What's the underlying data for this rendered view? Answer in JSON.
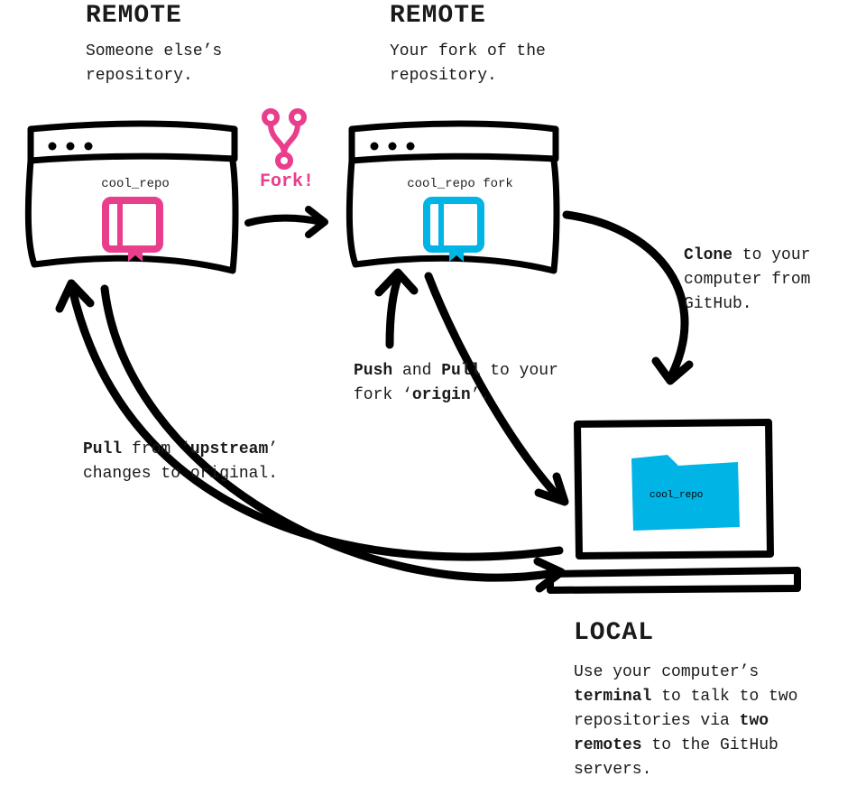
{
  "upstream_remote": {
    "title": "REMOTE",
    "desc": "Someone else’s repository.",
    "repo_label": "cool_repo"
  },
  "origin_remote": {
    "title": "REMOTE",
    "desc": "Your fork of the repository.",
    "repo_label": "cool_repo fork"
  },
  "fork": {
    "label": "Fork!"
  },
  "clone": {
    "t1": "Clone",
    "t2": " to your computer from GitHub."
  },
  "pushpull": {
    "t1": "Push",
    "t2": " and ",
    "t3": "Pull",
    "t4": " to your fork ‘",
    "t5": "origin",
    "t6": "’."
  },
  "pull_upstream": {
    "t1": "Pull",
    "t2": " from ‘",
    "t3": "upstream",
    "t4": "’ changes to original."
  },
  "local": {
    "title": "LOCAL",
    "folder_label": "cool_repo",
    "desc_1": "Use your computer’s ",
    "desc_2": "terminal",
    "desc_3": " to talk to two repositories via ",
    "desc_4": "two remotes",
    "desc_5": " to the GitHub servers."
  }
}
